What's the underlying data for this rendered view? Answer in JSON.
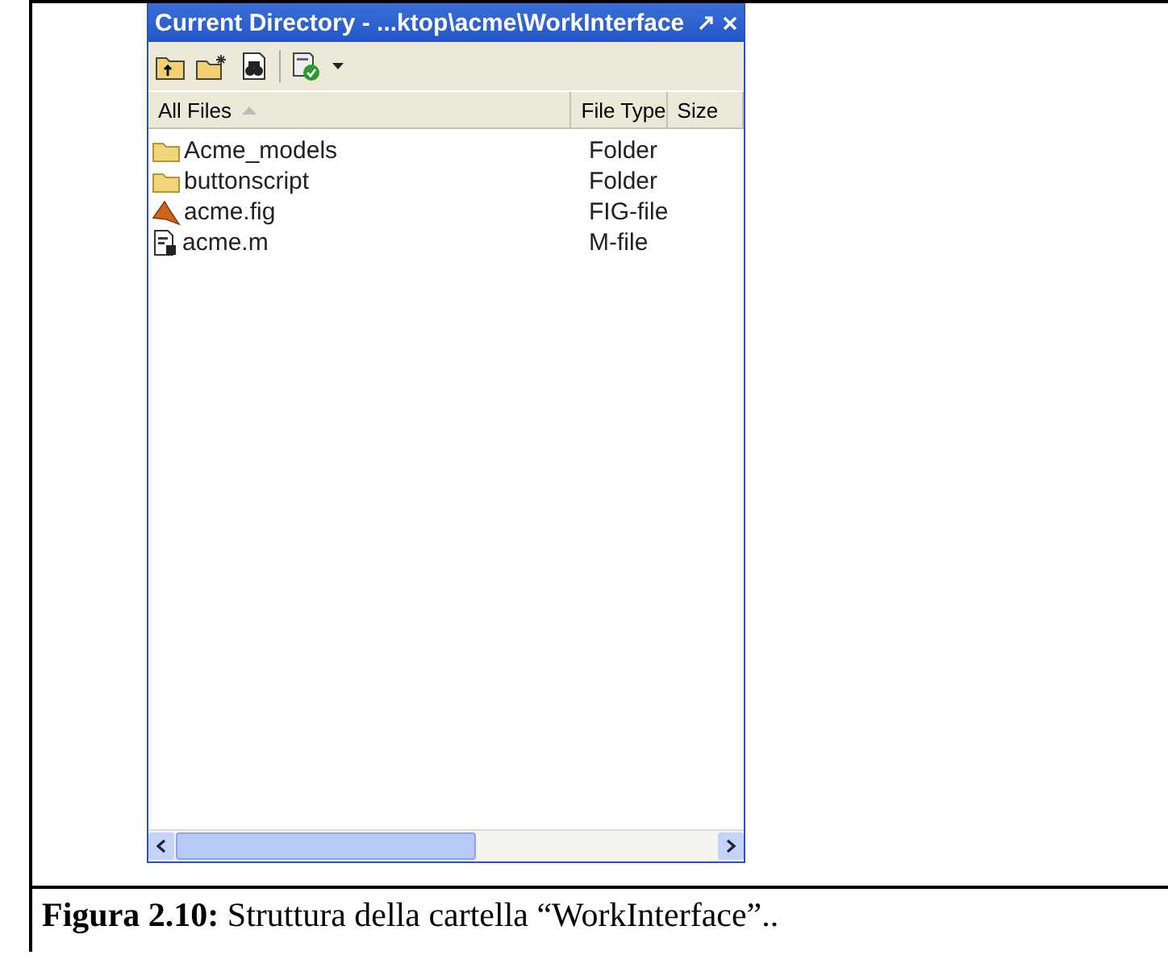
{
  "window": {
    "title": "Current Directory - ...ktop\\acme\\WorkInterface"
  },
  "table": {
    "columns": [
      {
        "label": "All Files",
        "sorted": true
      },
      {
        "label": "File Type",
        "sorted": false
      },
      {
        "label": "Size",
        "sorted": false
      }
    ],
    "rows": [
      {
        "name": "Acme_models",
        "type": "Folder",
        "kind": "folder"
      },
      {
        "name": "buttonscript",
        "type": "Folder",
        "kind": "folder"
      },
      {
        "name": "acme.fig",
        "type": "FIG-file",
        "kind": "fig"
      },
      {
        "name": "acme.m",
        "type": "M-file",
        "kind": "mfile"
      }
    ]
  },
  "caption": "**Figura 2.10:** Struttura della cartella “WorkInterface”.."
}
